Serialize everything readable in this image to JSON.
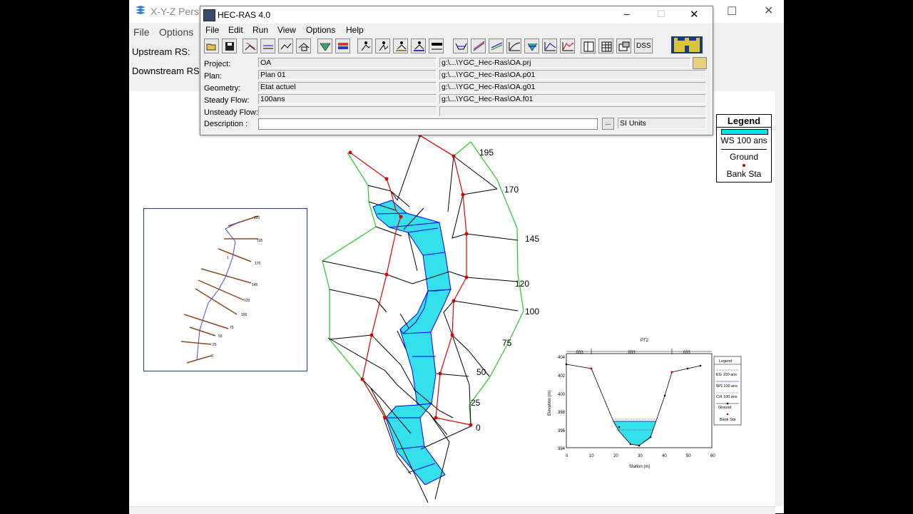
{
  "xyz_window": {
    "title": "X-Y-Z Persp",
    "menu": [
      "File",
      "Options"
    ],
    "upstream_label": "Upstream RS:",
    "downstream_label": "Downstream RS:"
  },
  "hecras": {
    "title": "HEC-RAS 4.0",
    "menu": [
      "File",
      "Edit",
      "Run",
      "View",
      "Options",
      "Help"
    ],
    "toolbar_icons": [
      "open-icon",
      "save-icon",
      "geometry-icon",
      "steady-flow-icon",
      "unsteady-flow-icon",
      "quasi-unsteady-icon",
      "sediment-icon",
      "water-quality-icon",
      "steady-analysis-icon",
      "unsteady-analysis-icon",
      "sediment-analysis-icon",
      "wq-analysis-icon",
      "hydraulic-design-icon",
      "cross-section-plot-icon",
      "profile-plot-icon",
      "rating-curve-icon",
      "general-profile-icon",
      "xyz-plot-icon",
      "stage-flow-icon",
      "hydrograph-icon",
      "detailed-table-icon",
      "profile-table-icon",
      "summary-icon",
      "dss-icon",
      "usace-castle-icon"
    ],
    "dss_label": "DSS",
    "fields": {
      "project_label": "Project:",
      "project_value": "OA",
      "project_path": "g:\\...\\YGC_Hec-Ras\\OA.prj",
      "plan_label": "Plan:",
      "plan_value": "Plan 01",
      "plan_path": "g:\\...\\YGC_Hec-Ras\\OA.p01",
      "geometry_label": "Geometry:",
      "geometry_value": "Etat actuel",
      "geometry_path": "g:\\...\\YGC_Hec-Ras\\OA.g01",
      "steady_label": "Steady Flow:",
      "steady_value": "100ans",
      "steady_path": "g:\\...\\YGC_Hec-Ras\\OA.f01",
      "unsteady_label": "Unsteady Flow:",
      "unsteady_value": "",
      "unsteady_path": "",
      "description_label": "Description :",
      "description_value": "",
      "ellipsis": "...",
      "units": "SI Units"
    }
  },
  "legend": {
    "title": "Legend",
    "ws": "WS 100 ans",
    "ground": "Ground",
    "bank": "Bank Sta",
    "ws_color": "#00e5ee"
  },
  "plot": {
    "station_labels": [
      "195",
      "170",
      "145",
      "120",
      "100",
      "75",
      "50",
      "25",
      "0"
    ],
    "water_color": "#33e0ec",
    "bank_color": "#dd0000",
    "edge_color": "#22cc22"
  },
  "inset_plan": {
    "station_labels": [
      "220",
      "195",
      "170",
      "145",
      "120",
      "100",
      "75",
      "50",
      "25",
      "0"
    ],
    "rs_marker": "1"
  },
  "inset_xs": {
    "title": "PT2",
    "n_values": [
      ".033",
      ".033",
      ".033"
    ],
    "ylabel": "Elevation (m)",
    "xlabel": "Station (m)",
    "y_ticks": [
      "404",
      "402",
      "400",
      "398",
      "396",
      "394"
    ],
    "x_ticks": [
      "0",
      "10",
      "20",
      "30",
      "40",
      "50",
      "60"
    ],
    "legend_title": "Legend",
    "legend_items": [
      "EG 100 ans",
      "WS 100 ans",
      "Crit 100 ans",
      "Ground",
      "Bank Sta"
    ]
  }
}
